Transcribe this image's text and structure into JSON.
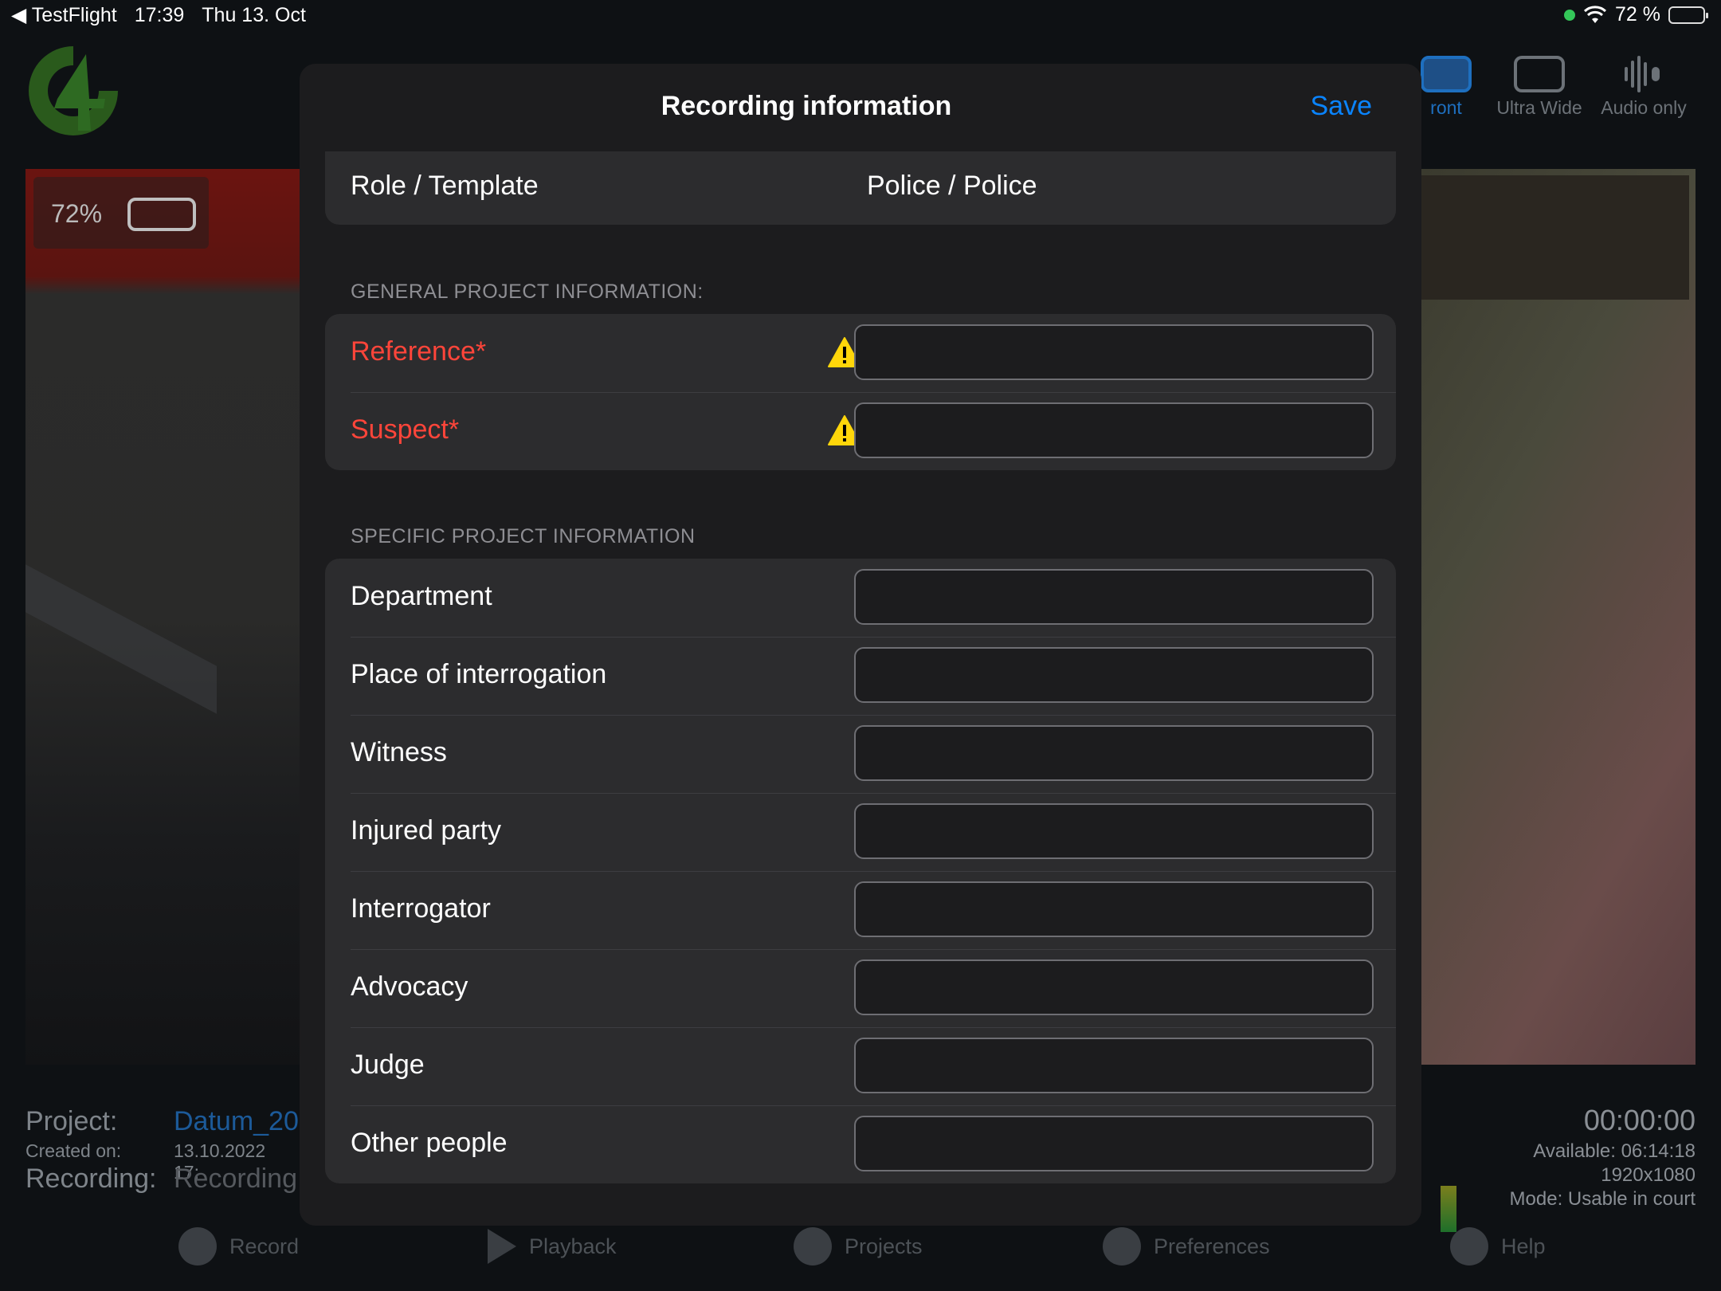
{
  "status_bar": {
    "back_app": "TestFlight",
    "time": "17:39",
    "date": "Thu 13. Oct",
    "battery": "72 %"
  },
  "background": {
    "battery_overlay": "72%",
    "toolbar": [
      {
        "label": "ront",
        "icon": "camera-rotate-icon",
        "active": true
      },
      {
        "label": "Ultra Wide",
        "icon": "camera-rotate-icon",
        "active": false
      },
      {
        "label": "Audio only",
        "icon": "microphone-waveform-icon",
        "active": false
      }
    ],
    "project": {
      "project_label": "Project:",
      "project_value": "Datum_20",
      "created_label": "Created on:",
      "created_value": "13.10.2022 17:",
      "recording_label": "Recording:",
      "recording_value": "Recording"
    },
    "recording_info": {
      "timer": "00:00:00",
      "available": "Available: 06:14:18",
      "resolution": "1920x1080",
      "mode": "Mode: Usable in court"
    },
    "tabs": [
      {
        "label": "Record",
        "icon": "camera-icon"
      },
      {
        "label": "Playback",
        "icon": "play-icon"
      },
      {
        "label": "Projects",
        "icon": "pencil-icon"
      },
      {
        "label": "Preferences",
        "icon": "gear-icon"
      },
      {
        "label": "Help",
        "icon": "question-icon"
      }
    ]
  },
  "modal": {
    "title": "Recording information",
    "save_label": "Save",
    "role_label": "Role / Template",
    "role_value": "Police / Police",
    "general_header": "GENERAL PROJECT INFORMATION:",
    "general_fields": [
      {
        "label": "Reference*",
        "value": "",
        "required": true
      },
      {
        "label": "Suspect*",
        "value": "",
        "required": true
      }
    ],
    "specific_header": "SPECIFIC PROJECT INFORMATION",
    "specific_fields": [
      {
        "label": "Department",
        "value": ""
      },
      {
        "label": "Place of interrogation",
        "value": ""
      },
      {
        "label": "Witness",
        "value": ""
      },
      {
        "label": "Injured party",
        "value": ""
      },
      {
        "label": "Interrogator",
        "value": ""
      },
      {
        "label": "Advocacy",
        "value": ""
      },
      {
        "label": "Judge",
        "value": ""
      },
      {
        "label": "Other people",
        "value": ""
      }
    ],
    "colors": {
      "accent": "#0a84ff",
      "required": "#ff453a",
      "warning": "#ffd60a"
    }
  }
}
